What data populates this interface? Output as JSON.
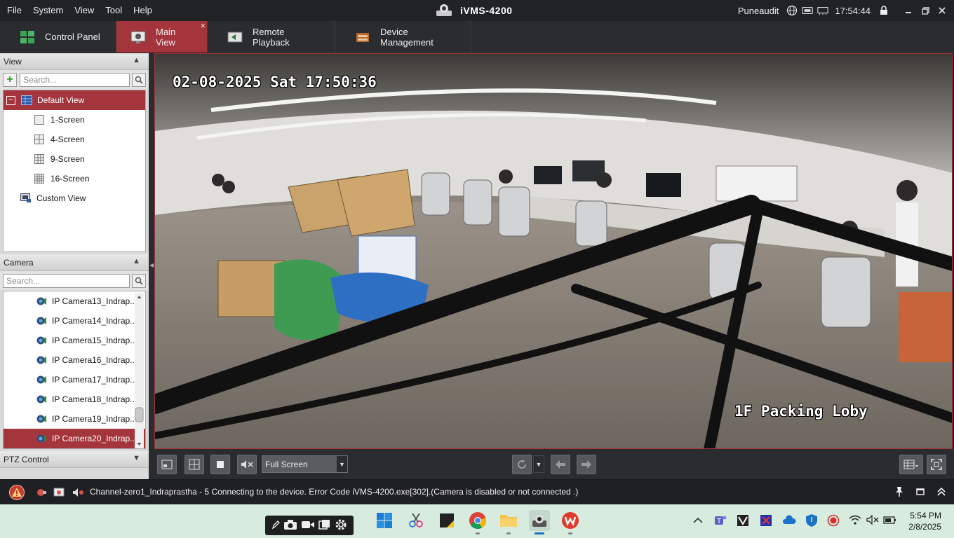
{
  "menubar": {
    "items": [
      "File",
      "System",
      "View",
      "Tool",
      "Help"
    ]
  },
  "app": {
    "title": "iVMS-4200",
    "user": "Puneaudit",
    "clock": "17:54:44"
  },
  "tabs": [
    {
      "label": "Control Panel"
    },
    {
      "label": "Main View"
    },
    {
      "label": "Remote Playback"
    },
    {
      "label": "Device Management"
    }
  ],
  "view_panel": {
    "title": "View",
    "search_placeholder": "Search...",
    "default_view": "Default View",
    "layouts": [
      "1-Screen",
      "4-Screen",
      "9-Screen",
      "16-Screen"
    ],
    "custom_view": "Custom View"
  },
  "camera_panel": {
    "title": "Camera",
    "search_placeholder": "Search...",
    "cameras": [
      "IP Camera13_Indrap...",
      "IP Camera14_Indrap...",
      "IP Camera15_Indrap...",
      "IP Camera16_Indrap...",
      "IP Camera17_Indrap...",
      "IP Camera18_Indrap...",
      "IP Camera19_Indrap...",
      "IP Camera20_Indrap..."
    ],
    "selected_index": 7
  },
  "ptz_panel": {
    "title": "PTZ Control"
  },
  "video": {
    "timestamp": "02-08-2025 Sat 17:50:36",
    "channel_name": "1F Packing Loby"
  },
  "toolbar": {
    "screen_mode": "Full Screen"
  },
  "status": {
    "message": "Channel-zero1_Indraprastha - 5 Connecting to the device. Error Code iVMS-4200.exe[302].(Camera is disabled or not connected .)"
  },
  "taskbar": {
    "time": "5:54 PM",
    "date": "2/8/2025"
  },
  "colors": {
    "accent": "#a5353c",
    "chrome": "#2a2c30",
    "taskbar": "#d7ecdf"
  }
}
